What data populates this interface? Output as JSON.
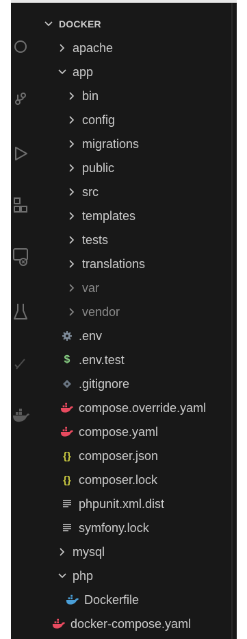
{
  "explorer": {
    "section_title": "DOCKER",
    "items": [
      {
        "label": "apache"
      },
      {
        "label": "app"
      },
      {
        "label": "bin"
      },
      {
        "label": "config"
      },
      {
        "label": "migrations"
      },
      {
        "label": "public"
      },
      {
        "label": "src"
      },
      {
        "label": "templates"
      },
      {
        "label": "tests"
      },
      {
        "label": "translations"
      },
      {
        "label": "var"
      },
      {
        "label": "vendor"
      },
      {
        "label": ".env"
      },
      {
        "label": ".env.test"
      },
      {
        "label": ".gitignore"
      },
      {
        "label": "compose.override.yaml"
      },
      {
        "label": "compose.yaml"
      },
      {
        "label": "composer.json"
      },
      {
        "label": "composer.lock"
      },
      {
        "label": "phpunit.xml.dist"
      },
      {
        "label": "symfony.lock"
      },
      {
        "label": "mysql"
      },
      {
        "label": "php"
      },
      {
        "label": "Dockerfile"
      },
      {
        "label": "docker-compose.yaml"
      }
    ],
    "icon_glyphs": {
      "dollar": "$",
      "braces": "{}"
    }
  },
  "colors": {
    "background": "#181818",
    "text": "#cccccc",
    "dim_text": "#8b8b8b",
    "gear": "#7f8c9a",
    "dollar": "#89d185",
    "git": "#6b7784",
    "yaml": "#e84a5f",
    "json": "#cbcb41",
    "docker": "#4a9fd8"
  }
}
